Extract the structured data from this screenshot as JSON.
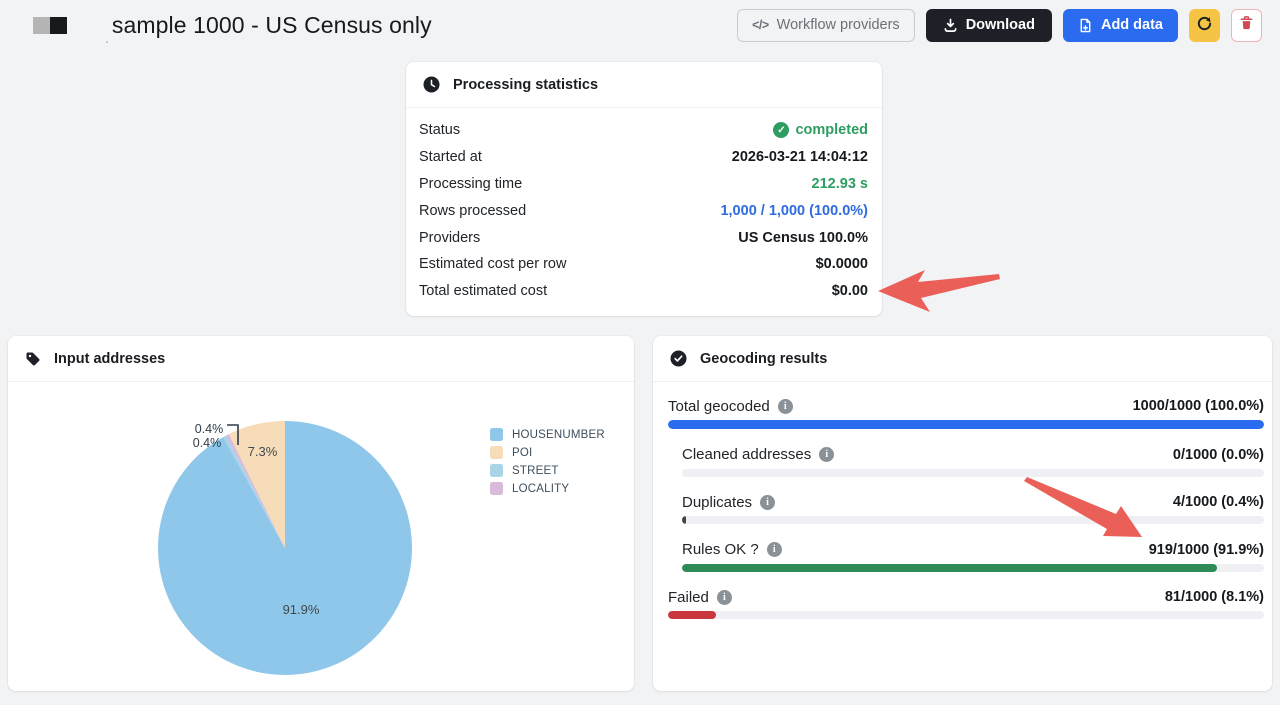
{
  "header": {
    "title_prefix": ".",
    "title": "sample 1000 - US Census only",
    "buttons": {
      "workflow": "Workflow providers",
      "workflow_icon_glyph": "</>",
      "download": "Download",
      "add_data": "Add data"
    }
  },
  "stats": {
    "title": "Processing statistics",
    "rows": [
      {
        "label": "Status",
        "value": "completed"
      },
      {
        "label": "Started at",
        "value": "2026-03-21 14:04:12"
      },
      {
        "label": "Processing time",
        "value": "212.93 s"
      },
      {
        "label": "Rows processed",
        "value": "1,000 / 1,000 (100.0%)"
      },
      {
        "label": "Providers",
        "value": "US Census 100.0%"
      },
      {
        "label": "Estimated cost per row",
        "value": "$0.0000"
      },
      {
        "label": "Total estimated cost",
        "value": "$0.00"
      }
    ]
  },
  "input_addresses": {
    "title": "Input addresses"
  },
  "chart_data": {
    "type": "pie",
    "title": "Input addresses",
    "legend_position": "right",
    "categories": [
      "HOUSENUMBER",
      "POI",
      "STREET",
      "LOCALITY"
    ],
    "values": [
      91.9,
      7.3,
      0.4,
      0.4
    ],
    "unit": "%",
    "slices_draw_order": [
      {
        "label": "HOUSENUMBER",
        "value": 91.9,
        "text": "91.9%",
        "color": "#8ec7e9"
      },
      {
        "label": "STREET",
        "value": 0.4,
        "text": "0.4%",
        "color": "#a8d4e6"
      },
      {
        "label": "LOCALITY",
        "value": 0.4,
        "text": "0.4%",
        "color": "#d9bada"
      },
      {
        "label": "POI",
        "value": 7.3,
        "text": "7.3%",
        "color": "#f6dcb9"
      }
    ],
    "legend": [
      {
        "label": "HOUSENUMBER",
        "color": "#8ec7e9"
      },
      {
        "label": "POI",
        "color": "#f6dcb9"
      },
      {
        "label": "STREET",
        "color": "#a8d4e6"
      },
      {
        "label": "LOCALITY",
        "color": "#d9bada"
      }
    ]
  },
  "results": {
    "title": "Geocoding results",
    "rows": [
      {
        "label": "Total geocoded",
        "value": "1000/1000 (100.0%)",
        "pct": 100,
        "color": "#2b6bf0"
      },
      {
        "label": "Cleaned addresses",
        "value": "0/1000 (0.0%)",
        "pct": 0,
        "color": "#6c757d"
      },
      {
        "label": "Duplicates",
        "value": "4/1000 (0.4%)",
        "pct": 0.4,
        "color": "#3d444d"
      },
      {
        "label": "Rules OK ?",
        "value": "919/1000 (91.9%)",
        "pct": 91.9,
        "color": "#2e8b57"
      },
      {
        "label": "Failed",
        "value": "81/1000 (8.1%)",
        "pct": 8.1,
        "color": "#c9383f"
      }
    ]
  },
  "colors": {
    "accent_blue": "#2b6bf0",
    "success_green": "#2e9d61",
    "bar_green": "#2e8b57",
    "bar_red": "#c9383f",
    "warning_yellow": "#f6c445",
    "arrow_red": "#ea5f58",
    "dark": "#1d2127"
  }
}
